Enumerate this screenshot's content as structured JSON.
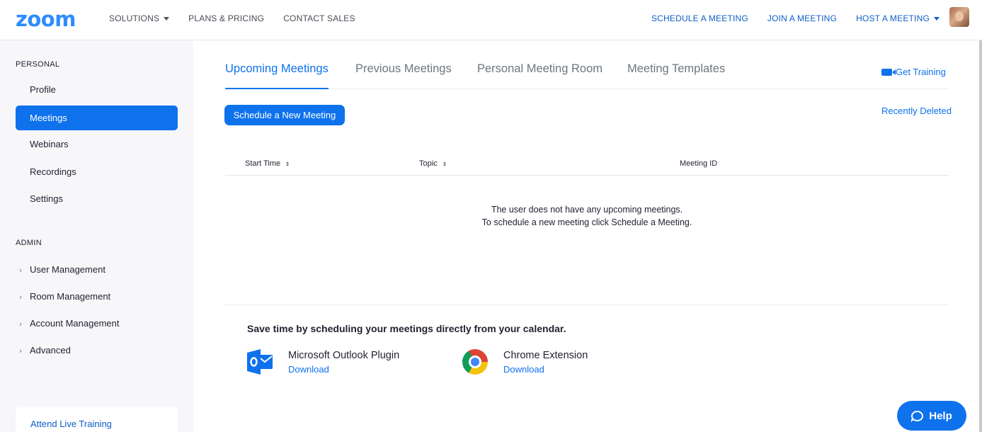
{
  "header": {
    "logo": "zoom",
    "left_nav": [
      {
        "label": "SOLUTIONS",
        "dropdown": true
      },
      {
        "label": "PLANS & PRICING",
        "dropdown": false
      },
      {
        "label": "CONTACT SALES",
        "dropdown": false
      }
    ],
    "right_nav": [
      {
        "label": "SCHEDULE A MEETING",
        "dropdown": false
      },
      {
        "label": "JOIN A MEETING",
        "dropdown": false
      },
      {
        "label": "HOST A MEETING",
        "dropdown": true
      }
    ]
  },
  "sidebar": {
    "personal_title": "PERSONAL",
    "personal_items": [
      {
        "label": "Profile",
        "active": false
      },
      {
        "label": "Meetings",
        "active": true
      },
      {
        "label": "Webinars",
        "active": false
      },
      {
        "label": "Recordings",
        "active": false
      },
      {
        "label": "Settings",
        "active": false
      }
    ],
    "admin_title": "ADMIN",
    "admin_items": [
      {
        "label": "User Management"
      },
      {
        "label": "Room Management"
      },
      {
        "label": "Account Management"
      },
      {
        "label": "Advanced"
      }
    ],
    "training_link": "Attend Live Training"
  },
  "main": {
    "tabs": [
      {
        "label": "Upcoming Meetings",
        "active": true
      },
      {
        "label": "Previous Meetings",
        "active": false
      },
      {
        "label": "Personal Meeting Room",
        "active": false
      },
      {
        "label": "Meeting Templates",
        "active": false
      }
    ],
    "get_training": "Get Training",
    "schedule_button": "Schedule a New Meeting",
    "recently_deleted": "Recently Deleted",
    "columns": [
      "Start Time",
      "Topic",
      "Meeting ID"
    ],
    "empty_line1": "The user does not have any upcoming meetings.",
    "empty_line2": "To schedule a new meeting click Schedule a Meeting.",
    "calendar_title": "Save time by scheduling your meetings directly from your calendar.",
    "plugins": [
      {
        "name": "Microsoft Outlook Plugin",
        "link": "Download",
        "icon": "outlook-icon"
      },
      {
        "name": "Chrome Extension",
        "link": "Download",
        "icon": "chrome-icon"
      }
    ],
    "help_button": "Help"
  },
  "colors": {
    "brand_blue": "#2d8cff",
    "accent_blue": "#0e72ed",
    "sidebar_bg": "#f7f7fa"
  }
}
